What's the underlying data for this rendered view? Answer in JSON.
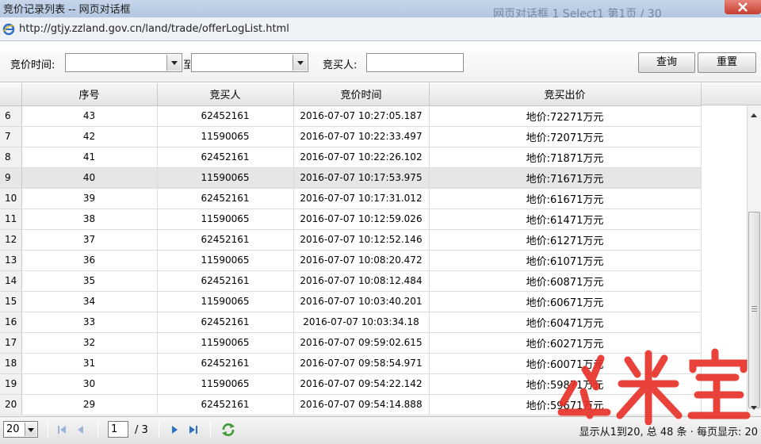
{
  "window": {
    "title": "竞价记录列表 -- 网页对话框",
    "background_text": "网页对话框  1 Select1  第1页  / 30"
  },
  "address": {
    "url": "http://gtjy.zzland.gov.cn/land/trade/offerLogList.html"
  },
  "filters": {
    "time_label": "竞价时间:",
    "time_from": "",
    "time_to": "",
    "separator": "至",
    "buyer_label": "竞买人:",
    "buyer_value": "",
    "query_label": "查询",
    "reset_label": "重置"
  },
  "table": {
    "columns": [
      "序号",
      "竞买人",
      "竞价时间",
      "竞买出价"
    ],
    "rows": [
      {
        "rownum": "6",
        "seq": "43",
        "buyer": "62452161",
        "time": "2016-07-07 10:27:05.187",
        "price": "地价:72271万元"
      },
      {
        "rownum": "7",
        "seq": "42",
        "buyer": "11590065",
        "time": "2016-07-07 10:22:33.497",
        "price": "地价:72071万元"
      },
      {
        "rownum": "8",
        "seq": "41",
        "buyer": "62452161",
        "time": "2016-07-07 10:22:26.102",
        "price": "地价:71871万元"
      },
      {
        "rownum": "9",
        "seq": "40",
        "buyer": "11590065",
        "time": "2016-07-07 10:17:53.975",
        "price": "地价:71671万元"
      },
      {
        "rownum": "10",
        "seq": "39",
        "buyer": "62452161",
        "time": "2016-07-07 10:17:31.012",
        "price": "地价:61671万元"
      },
      {
        "rownum": "11",
        "seq": "38",
        "buyer": "11590065",
        "time": "2016-07-07 10:12:59.026",
        "price": "地价:61471万元"
      },
      {
        "rownum": "12",
        "seq": "37",
        "buyer": "62452161",
        "time": "2016-07-07 10:12:52.146",
        "price": "地价:61271万元"
      },
      {
        "rownum": "13",
        "seq": "36",
        "buyer": "11590065",
        "time": "2016-07-07 10:08:20.472",
        "price": "地价:61071万元"
      },
      {
        "rownum": "14",
        "seq": "35",
        "buyer": "62452161",
        "time": "2016-07-07 10:08:12.484",
        "price": "地价:60871万元"
      },
      {
        "rownum": "15",
        "seq": "34",
        "buyer": "11590065",
        "time": "2016-07-07 10:03:40.201",
        "price": "地价:60671万元"
      },
      {
        "rownum": "16",
        "seq": "33",
        "buyer": "62452161",
        "time": "2016-07-07 10:03:34.18",
        "price": "地价:60471万元"
      },
      {
        "rownum": "17",
        "seq": "32",
        "buyer": "11590065",
        "time": "2016-07-07 09:59:02.615",
        "price": "地价:60271万元"
      },
      {
        "rownum": "18",
        "seq": "31",
        "buyer": "62452161",
        "time": "2016-07-07 09:58:54.971",
        "price": "地价:60071万元"
      },
      {
        "rownum": "19",
        "seq": "30",
        "buyer": "11590065",
        "time": "2016-07-07 09:54:22.142",
        "price": "地价:59871万元"
      },
      {
        "rownum": "20",
        "seq": "29",
        "buyer": "62452161",
        "time": "2016-07-07 09:54:14.888",
        "price": "地价:59671万元"
      }
    ],
    "selected_row": "9"
  },
  "pager": {
    "page_size": "20",
    "current_page": "1",
    "total_pages": "/ 3",
    "info": "显示从1到20, 总 48 条 · 每页显示: 20"
  },
  "watermark": {
    "text": "米宅",
    "color": "#e8332a"
  },
  "icons": [
    "ie-icon",
    "close-icon",
    "dropdown-arrow-icon",
    "first-page-icon",
    "prev-page-icon",
    "next-page-icon",
    "last-page-icon",
    "refresh-icon",
    "scroll-up-icon",
    "scroll-down-icon"
  ]
}
